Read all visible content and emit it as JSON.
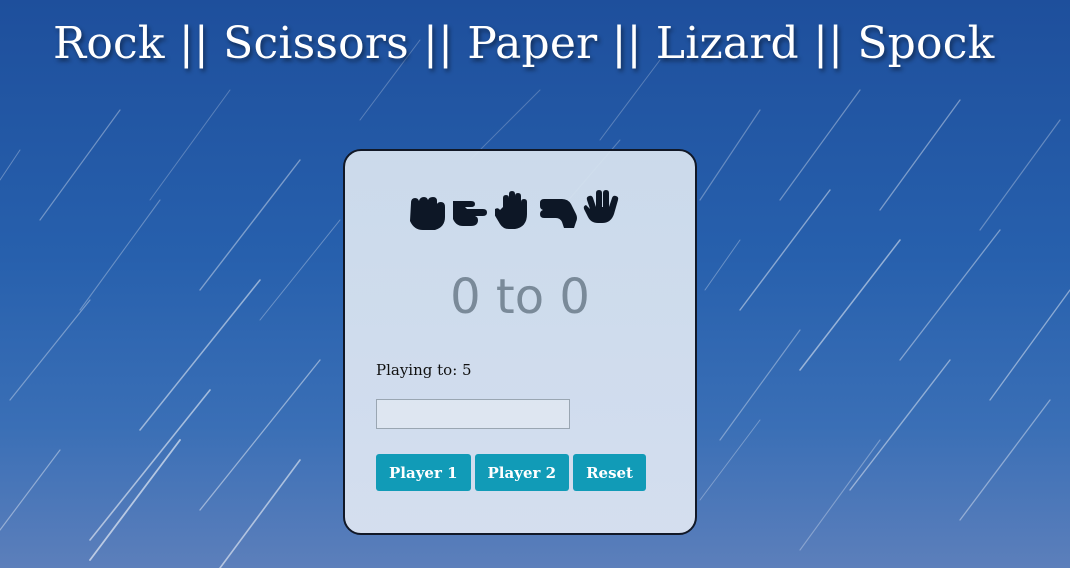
{
  "page": {
    "title": "Rock || Scissors || Paper || Lizard || Spock"
  },
  "card": {
    "icons": [
      "rock-hand-icon",
      "scissors-hand-icon",
      "paper-hand-icon",
      "lizard-hand-icon",
      "spock-hand-icon"
    ],
    "score": "0 to 0",
    "playing_to": "Playing to: 5",
    "input": {
      "value": "",
      "placeholder": ""
    },
    "buttons": {
      "player1": "Player 1",
      "player2": "Player 2",
      "reset": "Reset"
    }
  },
  "colors": {
    "accent": "#119bb7",
    "score_text": "#7a8a99",
    "background_top": "#1e4f9c",
    "card_border": "#111827"
  }
}
